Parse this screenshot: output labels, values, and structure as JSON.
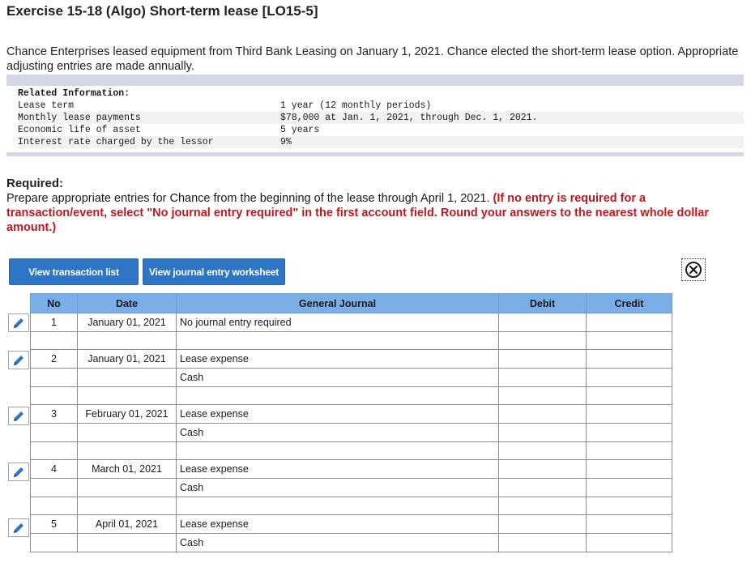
{
  "header": {
    "title": "Exercise 15-18 (Algo) Short-term lease [LO15-5]",
    "intro": "Chance Enterprises leased equipment from Third Bank Leasing on January 1, 2021. Chance elected the short-term lease option. Appropriate adjusting entries are made annually."
  },
  "related_info": {
    "heading": "Related Information:",
    "rows": [
      {
        "label": "Lease term",
        "value": "1 year (12 monthly periods)"
      },
      {
        "label": "Monthly lease payments",
        "value": "$78,000 at Jan. 1, 2021, through Dec. 1, 2021."
      },
      {
        "label": "Economic life of asset",
        "value": "5 years"
      },
      {
        "label": "Interest rate charged by the lessor",
        "value": "9%"
      }
    ]
  },
  "required": {
    "label": "Required:",
    "text": "Prepare appropriate entries for Chance from the beginning of the lease through April 1, 2021.",
    "instruction": "(If no entry is required for a transaction/event, select \"No journal entry required\" in the first account field. Round your answers to the nearest whole dollar amount.)"
  },
  "buttons": {
    "view_transactions": "View transaction list",
    "view_worksheet": "View journal entry worksheet"
  },
  "journal": {
    "columns": [
      "No",
      "Date",
      "General Journal",
      "Debit",
      "Credit"
    ],
    "entries": [
      {
        "no": "1",
        "date": "January 01, 2021",
        "accounts": [
          "No journal entry required"
        ]
      },
      {
        "no": "2",
        "date": "January 01, 2021",
        "accounts": [
          "Lease expense",
          "Cash"
        ]
      },
      {
        "no": "3",
        "date": "February 01, 2021",
        "accounts": [
          "Lease expense",
          "Cash"
        ]
      },
      {
        "no": "4",
        "date": "March 01, 2021",
        "accounts": [
          "Lease expense",
          "Cash"
        ]
      },
      {
        "no": "5",
        "date": "April 01, 2021",
        "accounts": [
          "Lease expense",
          "Cash"
        ]
      }
    ]
  },
  "colors": {
    "button_blue": "#2e75c5",
    "table_header": "#7aaee6",
    "instruction_red": "#c0171e",
    "info_band": "#d3d9e4"
  },
  "icons": {
    "edit": "pencil-icon",
    "close": "close-circle-icon"
  }
}
